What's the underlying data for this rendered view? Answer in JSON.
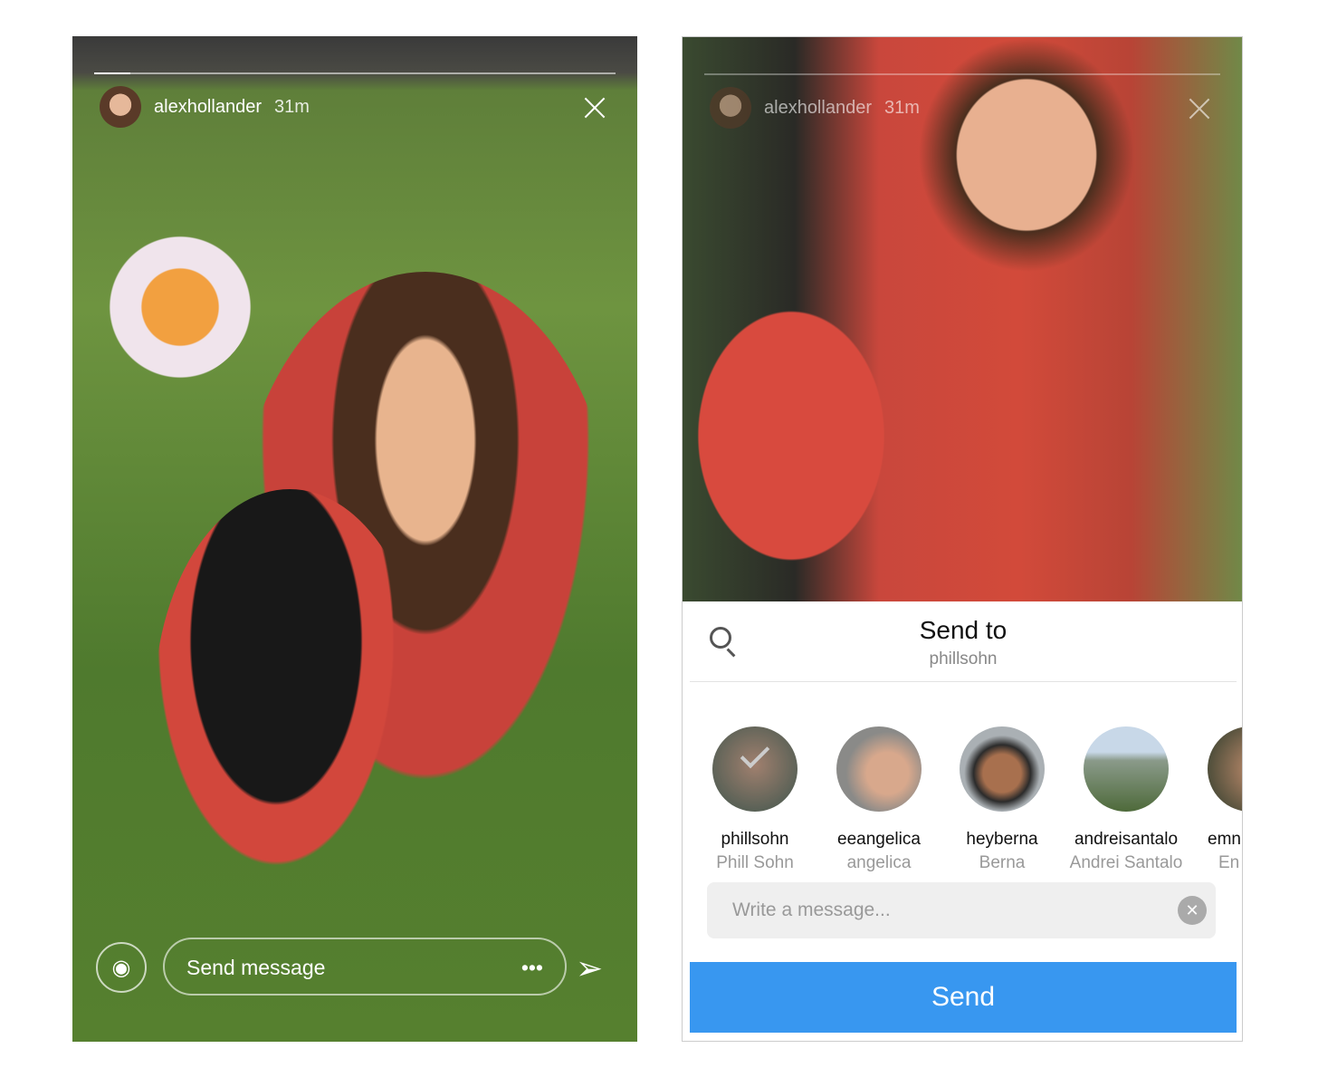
{
  "left_story": {
    "username": "alexhollander",
    "time": "31m",
    "progress_percent": 7,
    "message_placeholder": "Send message",
    "more_label": "•••",
    "icons": [
      "camera-icon",
      "paper-plane-icon",
      "close-icon"
    ]
  },
  "right_story": {
    "username": "alexhollander",
    "time": "31m"
  },
  "send_sheet": {
    "title": "Send to",
    "selected": "phillsohn",
    "contacts": [
      {
        "username": "phillsohn",
        "name": "Phill Sohn",
        "selected": true
      },
      {
        "username": "eeangelica",
        "name": "angelica",
        "selected": false
      },
      {
        "username": "heyberna",
        "name": "Berna",
        "selected": false
      },
      {
        "username": "andreisantalo",
        "name": "Andrei Santalo",
        "selected": false
      },
      {
        "username": "emn",
        "name": "En",
        "selected": false
      }
    ],
    "message_placeholder": "Write a message...",
    "send_label": "Send"
  },
  "colors": {
    "accent": "#3897f0"
  }
}
